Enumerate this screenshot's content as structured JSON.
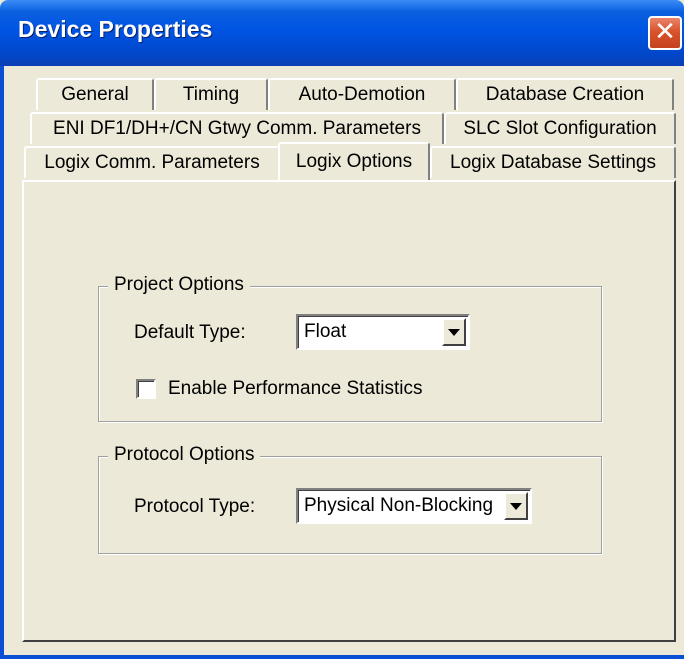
{
  "window": {
    "title": "Device Properties",
    "close_glyph": "✕",
    "title_bar_color": "#0054e3",
    "close_color": "#d8532c"
  },
  "tabs": {
    "row1": [
      {
        "label": "General"
      },
      {
        "label": "Timing"
      },
      {
        "label": "Auto-Demotion"
      },
      {
        "label": "Database Creation"
      }
    ],
    "row2": [
      {
        "label": "ENI DF1/DH+/CN Gtwy Comm. Parameters"
      },
      {
        "label": "SLC Slot Configuration"
      }
    ],
    "row3": [
      {
        "label": "Logix Comm. Parameters"
      },
      {
        "label": "Logix Options",
        "selected": true
      },
      {
        "label": "Logix Database Settings"
      }
    ]
  },
  "project_options": {
    "group_label": "Project Options",
    "default_type_label": "Default Type:",
    "default_type_value": "Float",
    "perf_stats_label": "Enable Performance Statistics",
    "perf_stats_checked": false
  },
  "protocol_options": {
    "group_label": "Protocol Options",
    "protocol_type_label": "Protocol Type:",
    "protocol_type_value": "Physical Non-Blocking"
  }
}
